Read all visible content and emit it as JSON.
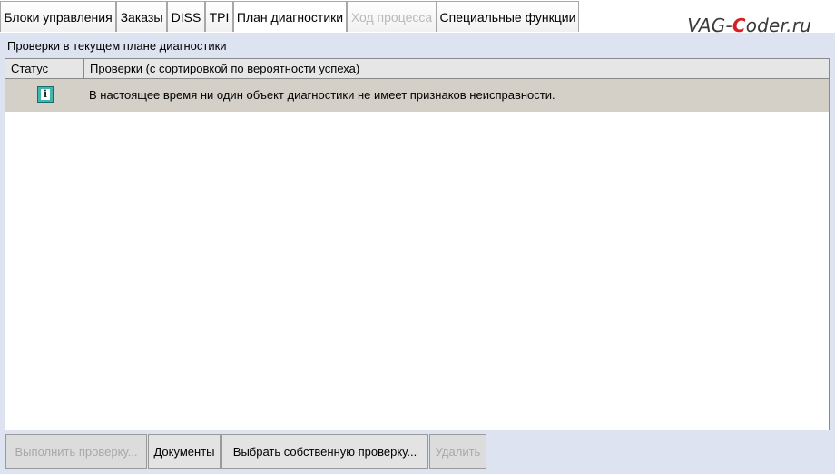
{
  "tabs": [
    {
      "label": "Блоки управления",
      "state": "normal"
    },
    {
      "label": "Заказы",
      "state": "normal"
    },
    {
      "label": "DISS",
      "state": "normal"
    },
    {
      "label": "TPI",
      "state": "normal"
    },
    {
      "label": "План диагностики",
      "state": "active"
    },
    {
      "label": "Ход процесса",
      "state": "disabled"
    },
    {
      "label": "Специальные функции",
      "state": "normal"
    }
  ],
  "watermark": {
    "prefix": "VAG-",
    "accent": "C",
    "suffix": "oder.ru"
  },
  "section_title": "Проверки в текущем плане диагностики",
  "table": {
    "columns": [
      "Статус",
      "Проверки (с сортировкой по вероятности успеха)"
    ],
    "rows": [
      {
        "status_icon": "info-icon",
        "text": "В настоящее время ни один объект диагностики не имеет признаков неисправности."
      }
    ]
  },
  "buttons": [
    {
      "label": "Выполнить проверку...",
      "enabled": false
    },
    {
      "label": "Документы",
      "enabled": true
    },
    {
      "label": "Выбрать собственную проверку...",
      "enabled": true
    },
    {
      "label": "Удалить",
      "enabled": false
    }
  ],
  "colors": {
    "background": "#dde3f1",
    "selected_row": "#d4d0c8",
    "info_icon": "#3fb5b1",
    "watermark_accent": "#d42020"
  }
}
